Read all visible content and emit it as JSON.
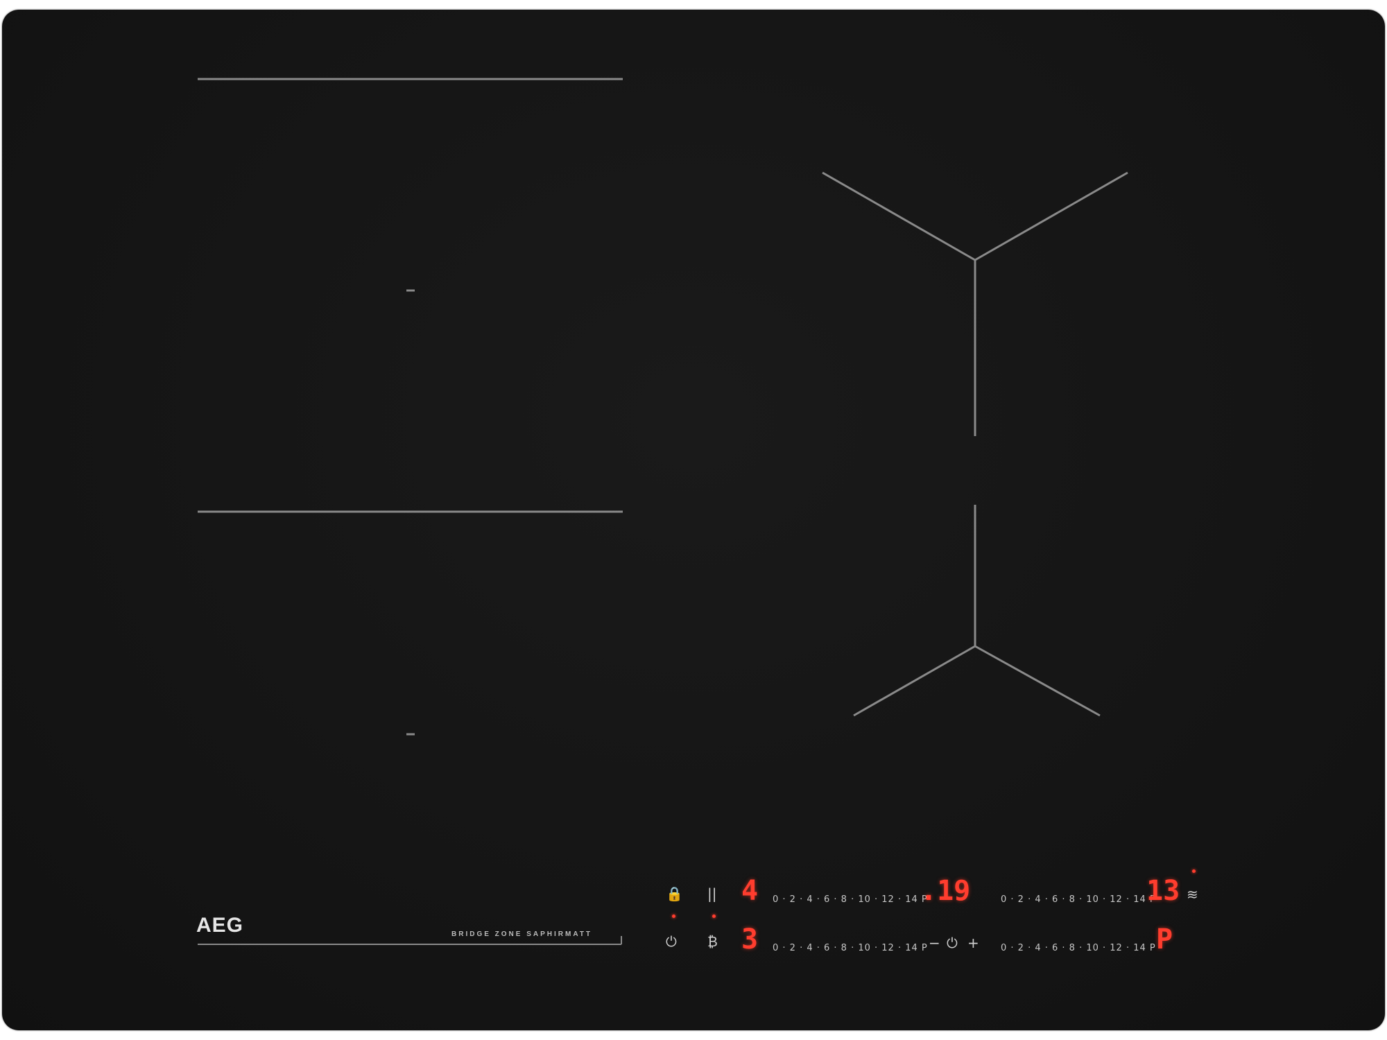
{
  "brand": {
    "logo": "AEG",
    "series": "BRIDGE ZONE SAPHIRMATT"
  },
  "controls": {
    "zone_scale": "0 · 2 · 4 · 6 · 8 · 10 · 12 · 14 P",
    "zones": [
      {
        "name": "front-left",
        "power_display": "4"
      },
      {
        "name": "rear-left",
        "power_display": "3"
      },
      {
        "name": "front-right",
        "power_display": "13"
      },
      {
        "name": "rear-right",
        "power_display": "P"
      }
    ],
    "timer_display": ".19",
    "timer_minus": "−",
    "timer_plus": "+",
    "icons": {
      "lock": "lock-icon",
      "pause": "pause-icon",
      "power": "power-icon",
      "hob2hood": "hob2hood-icon",
      "timer": "timer-icon",
      "bridge": "bridge-icon"
    },
    "lock_glyph": "🔒",
    "pause_glyph": "||",
    "power_glyph": "⏻",
    "hob2hood_glyph": "₿",
    "timer_glyph": "⏻",
    "bridge_glyph": "≋"
  },
  "colors": {
    "glass": "#141414",
    "lines": "#8a8a8a",
    "display": "#ff3d2e",
    "text": "#c8c8c8"
  }
}
